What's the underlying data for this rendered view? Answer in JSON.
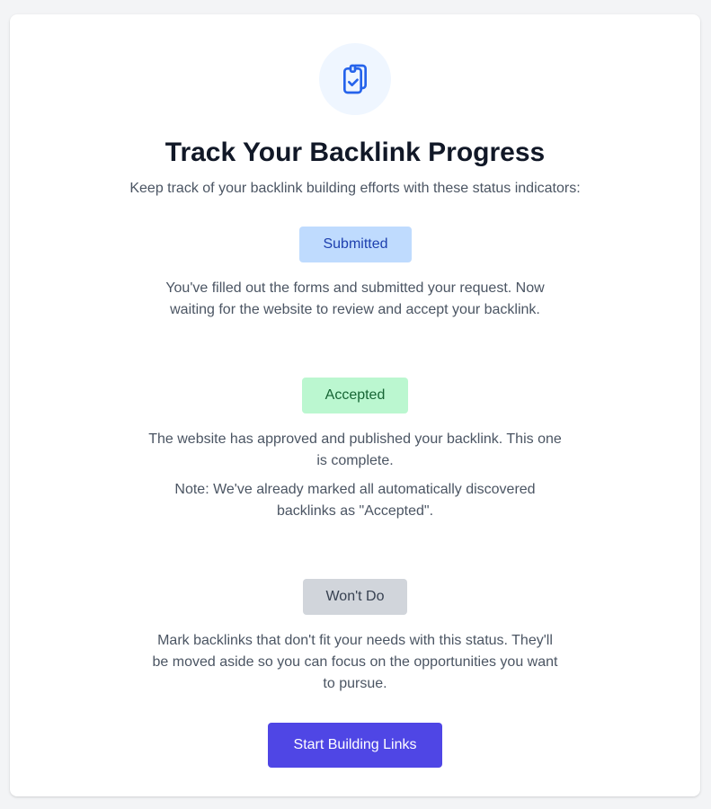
{
  "header": {
    "icon": "clipboard-check-icon",
    "title": "Track Your Backlink Progress",
    "subtitle": "Keep track of your backlink building efforts with these status indicators:"
  },
  "statuses": [
    {
      "label": "Submitted",
      "description": "You've filled out the forms and submitted your request. Now waiting for the website to review and accept your backlink.",
      "color": "#bfdbfe",
      "text_color": "#1e40af"
    },
    {
      "label": "Accepted",
      "description": "The website has approved and published your backlink. This one is complete.",
      "note": "Note: We've already marked all automatically discovered backlinks as \"Accepted\".",
      "color": "#bbf7d0",
      "text_color": "#166534"
    },
    {
      "label": "Won't Do",
      "description": "Mark backlinks that don't fit your needs with this status. They'll be moved aside so you can focus on the opportunities you want to pursue.",
      "color": "#d1d5db",
      "text_color": "#374151"
    }
  ],
  "cta": {
    "label": "Start Building Links",
    "color": "#4f46e5"
  }
}
